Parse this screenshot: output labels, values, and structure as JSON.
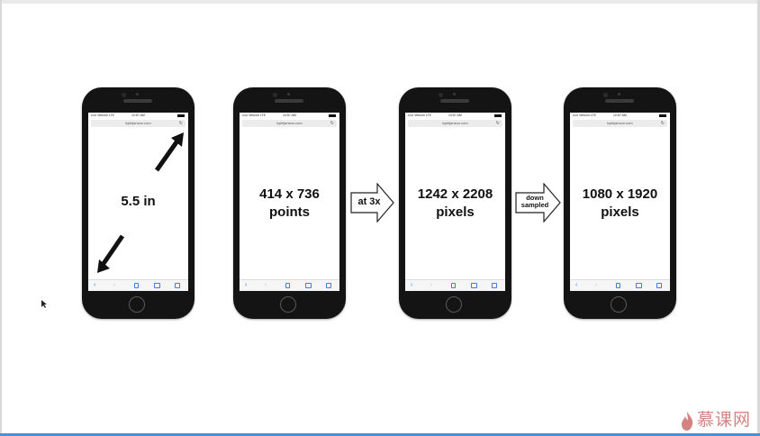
{
  "phones": [
    {
      "statusbar": {
        "carrier": "••••• Verizon LTE",
        "time": "10:57 AM"
      },
      "url": "kyleljanson.com",
      "label_line1": "5.5 in",
      "label_line2": ""
    },
    {
      "statusbar": {
        "carrier": "••••• Verizon LTE",
        "time": "10:57 AM"
      },
      "url": "kyleljanson.com",
      "label_line1": "414 x 736",
      "label_line2": "points"
    },
    {
      "statusbar": {
        "carrier": "••••• Verizon LTE",
        "time": "10:57 AM"
      },
      "url": "kyleljanson.com",
      "label_line1": "1242 x 2208",
      "label_line2": "pixels"
    },
    {
      "statusbar": {
        "carrier": "••••• Verizon LTE",
        "time": "10:57 AM"
      },
      "url": "kyleljanson.com",
      "label_line1": "1080 x 1920",
      "label_line2": "pixels"
    }
  ],
  "connectors": [
    {
      "line1": "at 3x",
      "line2": ""
    },
    {
      "line1": "down",
      "line2": "sampled"
    }
  ],
  "watermark": {
    "text": "慕课网",
    "color": "#d48383"
  },
  "colors": {
    "phone_body": "#141414",
    "toolbar_icon": "#3b7fe0"
  }
}
